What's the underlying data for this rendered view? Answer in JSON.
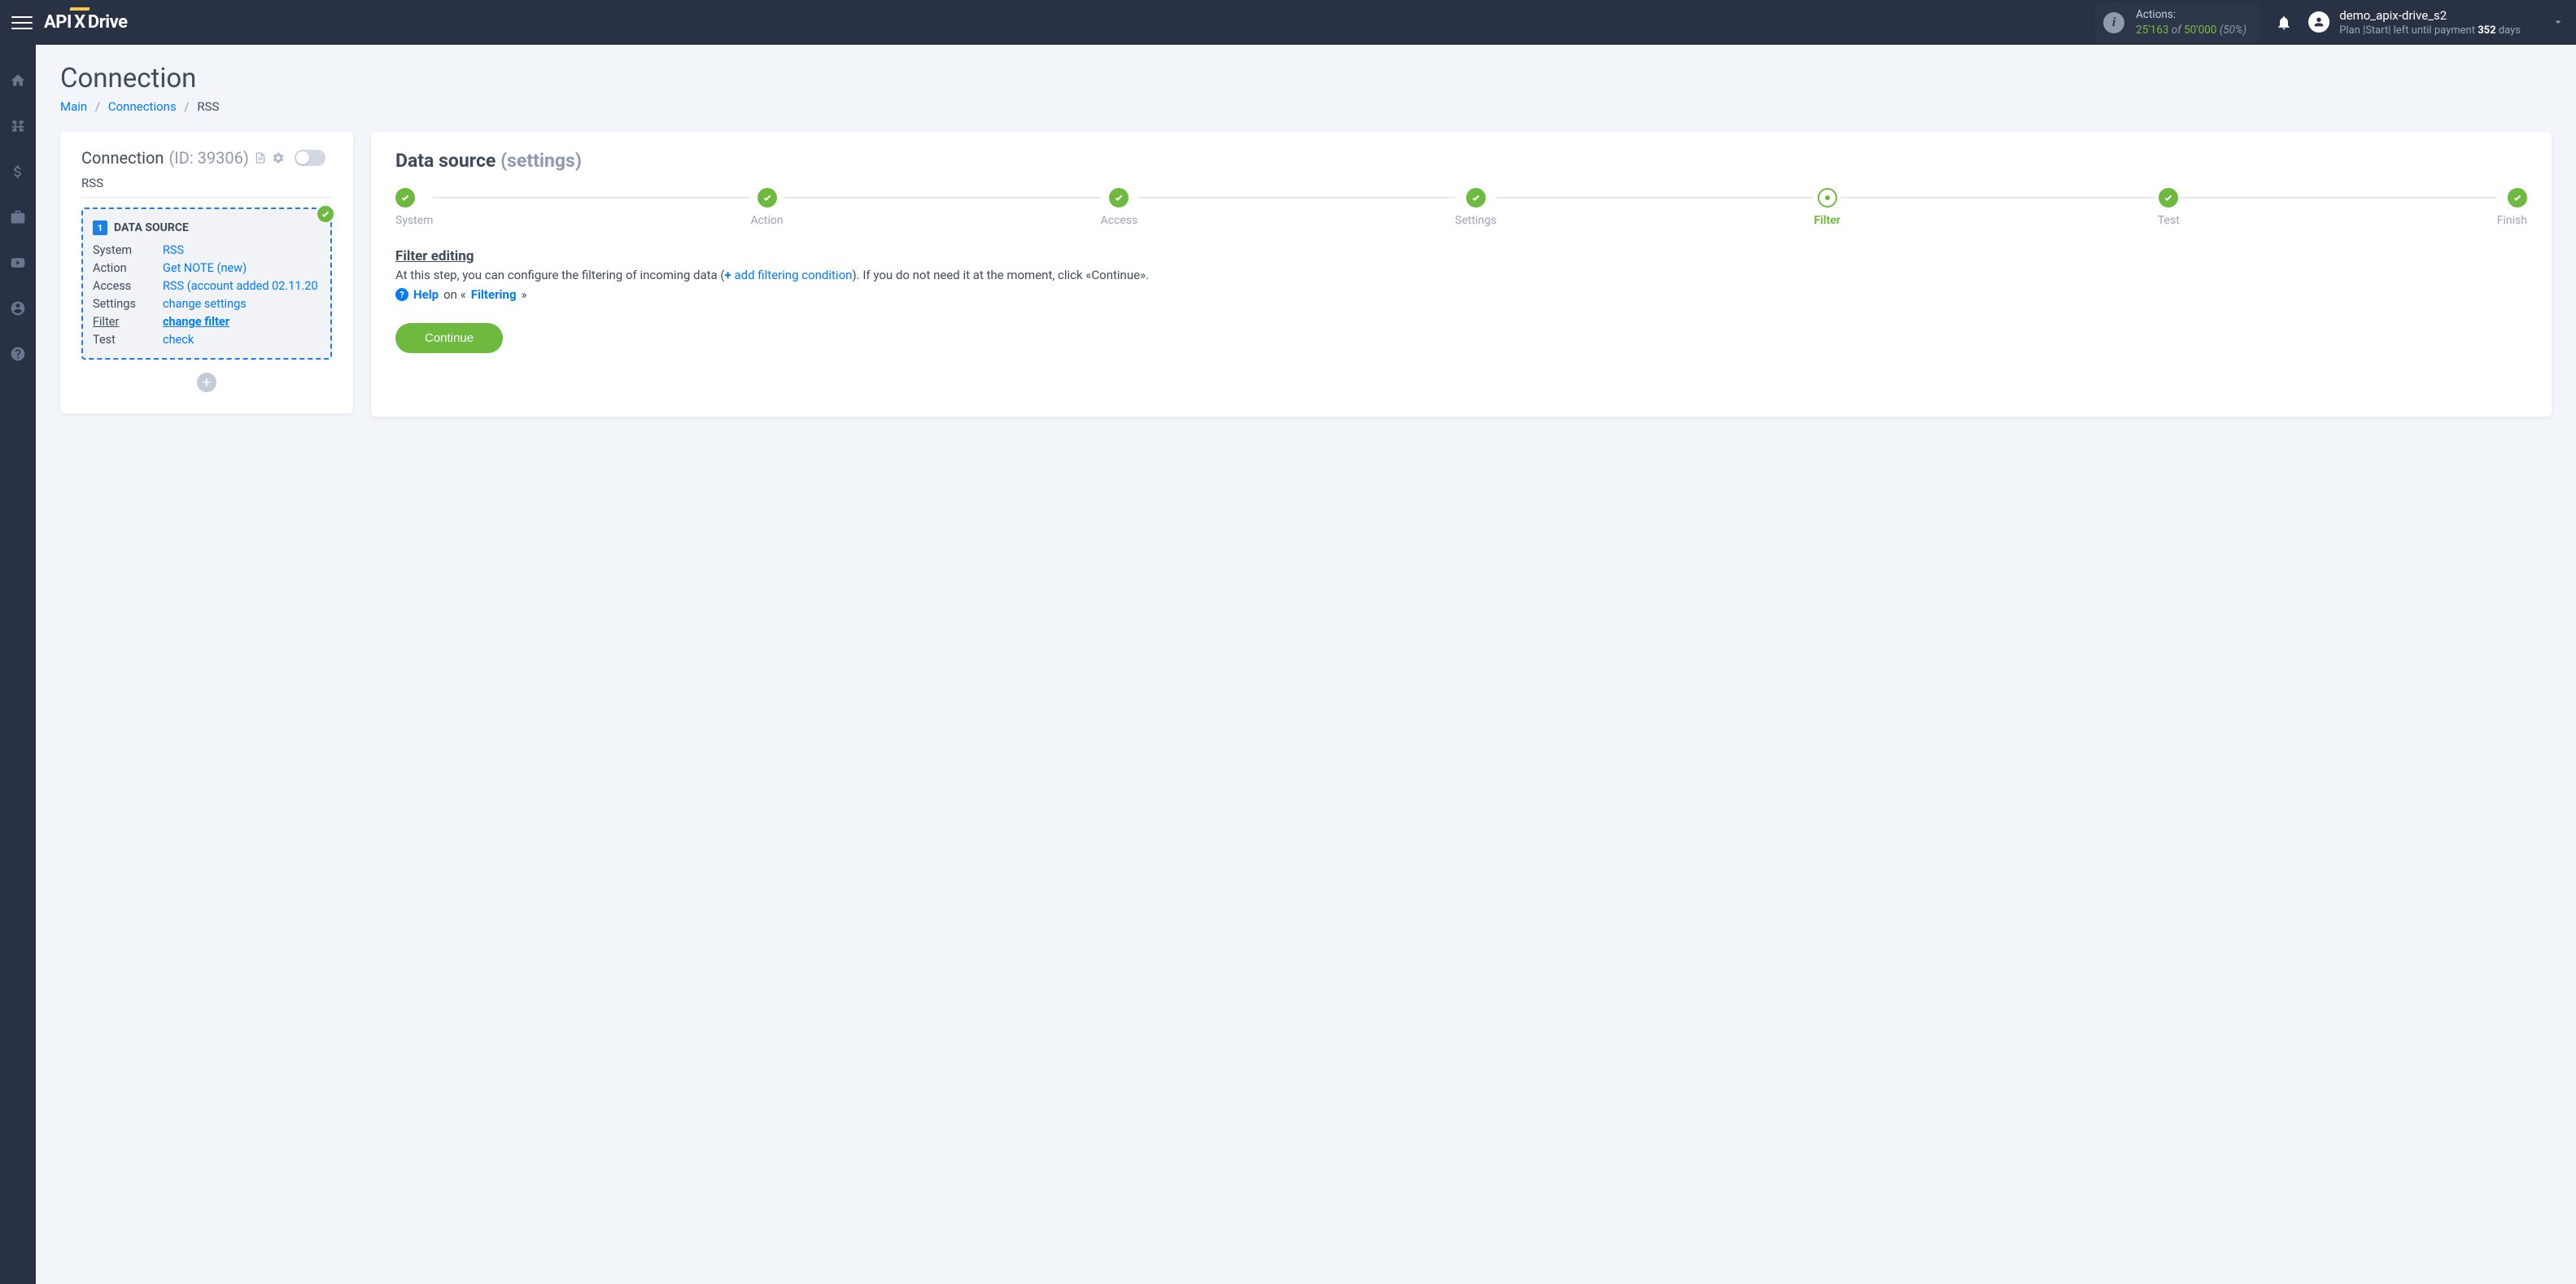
{
  "header": {
    "logo_api": "API",
    "logo_x": "X",
    "logo_drive": "Drive",
    "actions_label": "Actions:",
    "actions_used": "25'163",
    "actions_of": "of",
    "actions_total": "50'000",
    "actions_pct": "(50%)",
    "username": "demo_apix-drive_s2",
    "plan_prefix": "Plan |Start| left until payment ",
    "plan_days_num": "352",
    "plan_days_suffix": " days"
  },
  "page": {
    "title": "Connection",
    "breadcrumb_main": "Main",
    "breadcrumb_connections": "Connections",
    "breadcrumb_current": "RSS"
  },
  "left": {
    "title": "Connection",
    "id_text": "(ID: 39306)",
    "sub": "RSS",
    "ds_heading": "DATA SOURCE",
    "ds_num": "1",
    "rows": {
      "system_label": "System",
      "system_val": "RSS",
      "action_label": "Action",
      "action_val": "Get NOTE (new)",
      "access_label": "Access",
      "access_val": "RSS (account added 02.11.20",
      "settings_label": "Settings",
      "settings_val": "change settings",
      "filter_label": "Filter",
      "filter_val": "change filter",
      "test_label": "Test",
      "test_val": "check"
    }
  },
  "right": {
    "title": "Data source",
    "subtitle": "(settings)",
    "steps": [
      "System",
      "Action",
      "Access",
      "Settings",
      "Filter",
      "Test",
      "Finish"
    ],
    "filter_title": "Filter editing",
    "filter_desc_1": "At this step, you can configure the filtering of incoming data (",
    "filter_add": "add filtering condition",
    "filter_desc_2": "). If you do not need it at the moment, click «Continue».",
    "help_label": "Help",
    "help_on": " on «",
    "help_topic": "Filtering",
    "help_close": "»",
    "continue": "Continue"
  }
}
